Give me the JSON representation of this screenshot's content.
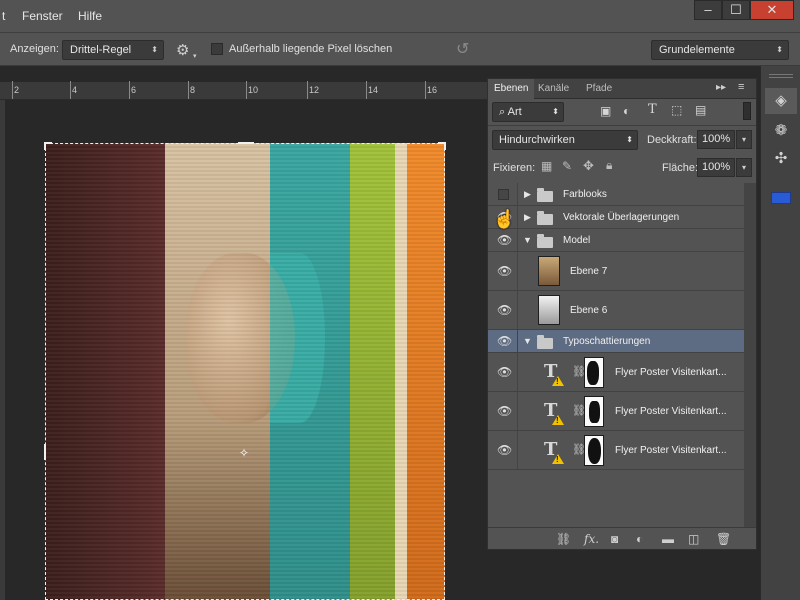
{
  "menubar": {
    "items": [
      "t",
      "Fenster",
      "Hilfe"
    ]
  },
  "window_controls": {
    "minimize": "–",
    "maximize": "☐",
    "close": "✕"
  },
  "options": {
    "show_label": "Anzeigen:",
    "overlay_select": "Drittel-Regel",
    "delete_outside_label": "Außerhalb liegende Pixel löschen",
    "workspace_select": "Grundelemente"
  },
  "ruler": {
    "labels": [
      "2",
      "4",
      "6",
      "8",
      "10",
      "12",
      "14",
      "16"
    ]
  },
  "panel": {
    "tabs": [
      "Ebenen",
      "Kanäle",
      "Pfade"
    ],
    "filter_select": "Art",
    "blend_mode": "Hindurchwirken",
    "opacity_label": "Deckkraft:",
    "opacity_value": "100%",
    "lock_label": "Fixieren:",
    "fill_label": "Fläche:",
    "fill_value": "100%"
  },
  "layers": [
    {
      "name": "Farblooks",
      "type": "group",
      "visible": false,
      "expanded": false
    },
    {
      "name": "Vektorale Überlagerungen",
      "type": "group",
      "visible": true,
      "expanded": false
    },
    {
      "name": "Model",
      "type": "group",
      "visible": true,
      "expanded": true
    },
    {
      "name": "Ebene 7",
      "type": "pixel",
      "visible": true
    },
    {
      "name": "Ebene 6",
      "type": "pixel",
      "visible": true
    },
    {
      "name": "Typoschattierungen",
      "type": "group",
      "visible": true,
      "expanded": true,
      "selected": true
    },
    {
      "name": "Flyer Poster Visitenkart...",
      "type": "smart-text",
      "visible": true
    },
    {
      "name": "Flyer Poster Visitenkart...",
      "type": "smart-text",
      "visible": true
    },
    {
      "name": "Flyer Poster Visitenkart...",
      "type": "smart-text",
      "visible": true
    }
  ],
  "colors": {
    "selection": "#5d6c82",
    "warning": "#f2c200",
    "close_button": "#c8402f",
    "swatch_blue": "#2a5bd7"
  }
}
